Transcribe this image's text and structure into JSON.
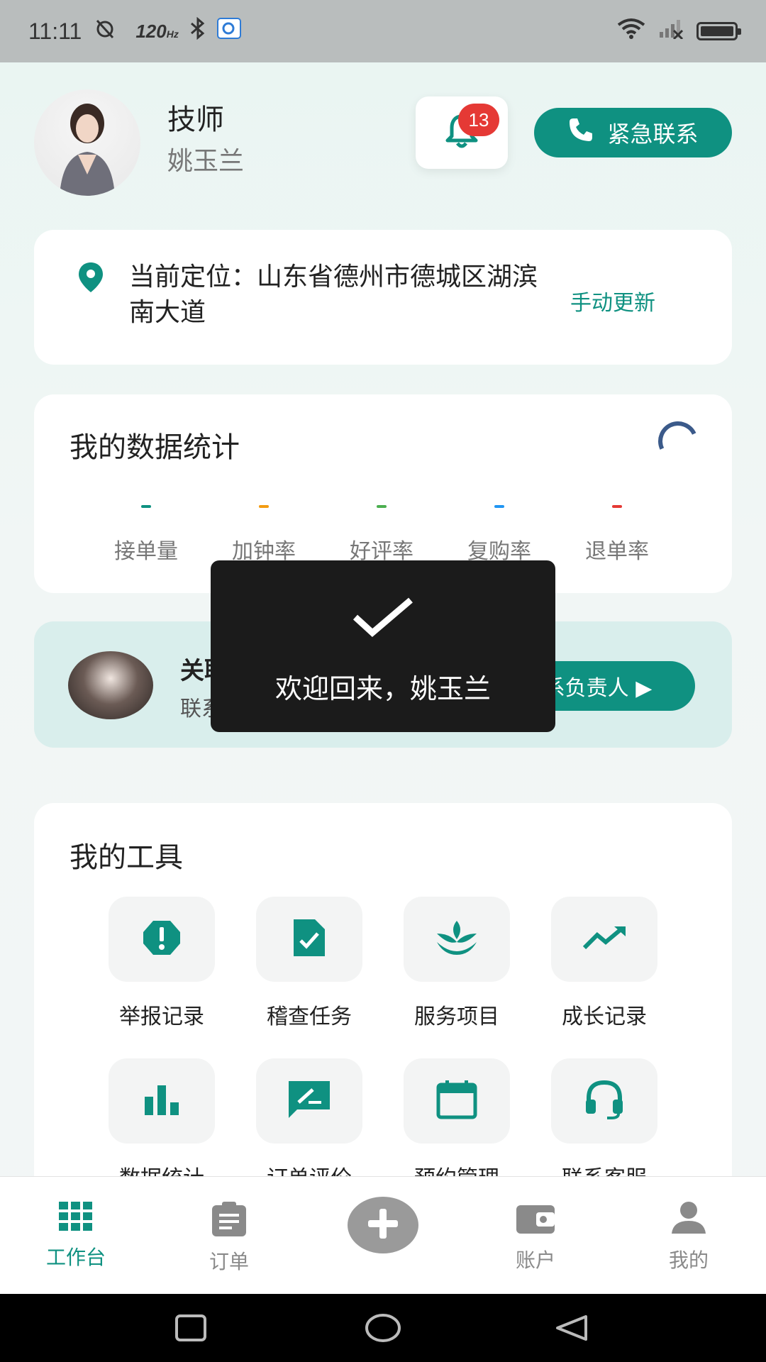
{
  "status_bar": {
    "time": "11:11",
    "refresh_rate": "120",
    "refresh_unit": "Hz"
  },
  "header": {
    "role": "技师",
    "name": "姚玉兰",
    "notification_count": "13",
    "emergency_label": "紧急联系"
  },
  "location": {
    "text": "当前定位：山东省德州市德城区湖滨南大道",
    "update_label": "手动更新"
  },
  "stats": {
    "title": "我的数据统计",
    "items": [
      {
        "label": "接单量",
        "value": "-",
        "color": "#0f9181"
      },
      {
        "label": "加钟率",
        "value": "-",
        "color": "#f39c12"
      },
      {
        "label": "好评率",
        "value": "-",
        "color": "#4caf50"
      },
      {
        "label": "复购率",
        "value": "-",
        "color": "#2196f3"
      },
      {
        "label": "退单率",
        "value": "-",
        "color": "#e53935"
      }
    ]
  },
  "manager": {
    "title": "关联的负责人",
    "contact": "联系方式",
    "button_label": "联系负责人 ▶"
  },
  "tools": {
    "title": "我的工具",
    "items": [
      {
        "label": "举报记录",
        "icon": "report-icon"
      },
      {
        "label": "稽查任务",
        "icon": "inspection-icon"
      },
      {
        "label": "服务项目",
        "icon": "lotus-icon"
      },
      {
        "label": "成长记录",
        "icon": "trending-up-icon"
      },
      {
        "label": "数据统计",
        "icon": "bar-chart-icon"
      },
      {
        "label": "订单评价",
        "icon": "review-icon"
      },
      {
        "label": "预约管理",
        "icon": "calendar-icon"
      },
      {
        "label": "联系客服",
        "icon": "headset-icon"
      }
    ]
  },
  "toast": {
    "message": "欢迎回来，姚玉兰"
  },
  "bottom_nav": {
    "items": [
      {
        "label": "工作台",
        "active": true
      },
      {
        "label": "订单",
        "active": false
      },
      {
        "label": "账户",
        "active": false
      },
      {
        "label": "我的",
        "active": false
      }
    ]
  },
  "colors": {
    "accent": "#0f9181",
    "badge": "#e53935"
  }
}
